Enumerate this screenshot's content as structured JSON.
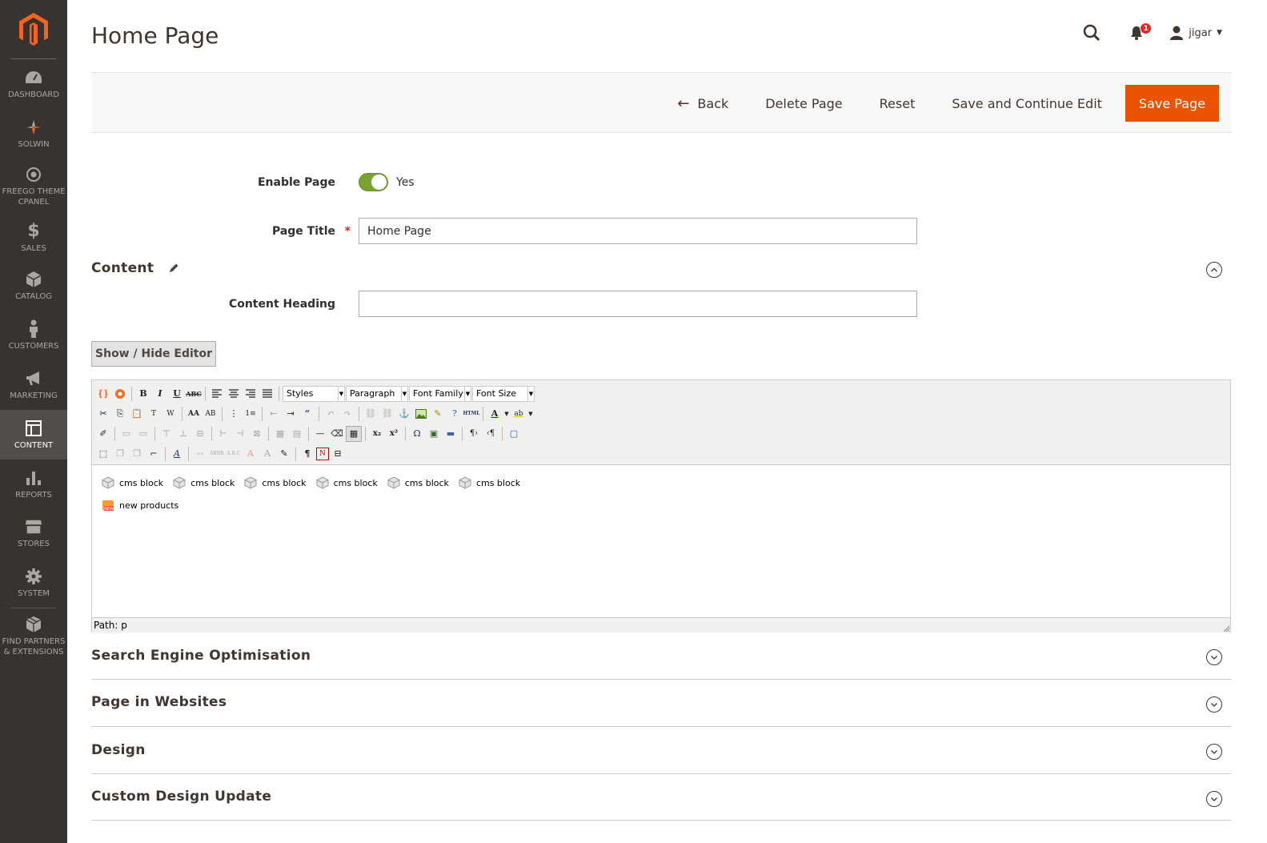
{
  "sidebar": {
    "items": [
      {
        "label": "DASHBOARD",
        "icon": "dashboard-icon"
      },
      {
        "label": "SOLWIN",
        "icon": "solwin-icon"
      },
      {
        "label": "FREEGO THEME CPANEL",
        "icon": "freego-icon"
      },
      {
        "label": "SALES",
        "icon": "dollar-icon"
      },
      {
        "label": "CATALOG",
        "icon": "box-icon"
      },
      {
        "label": "CUSTOMERS",
        "icon": "person-icon"
      },
      {
        "label": "MARKETING",
        "icon": "megaphone-icon"
      },
      {
        "label": "CONTENT",
        "icon": "layout-icon"
      },
      {
        "label": "REPORTS",
        "icon": "bar-chart-icon"
      },
      {
        "label": "STORES",
        "icon": "store-icon"
      },
      {
        "label": "SYSTEM",
        "icon": "gear-icon"
      },
      {
        "label": "FIND PARTNERS & EXTENSIONS",
        "icon": "blocks-icon"
      }
    ],
    "active": "CONTENT"
  },
  "header": {
    "title": "Home Page",
    "notification_count": "1",
    "username": "jigar"
  },
  "actions": {
    "back": "Back",
    "delete": "Delete Page",
    "reset": "Reset",
    "save_continue": "Save and Continue Edit",
    "save": "Save Page"
  },
  "form": {
    "enable_label": "Enable Page",
    "enable_value": "Yes",
    "title_label": "Page Title",
    "title_required": "*",
    "title_value": "Home Page"
  },
  "content_section": {
    "title": "Content",
    "heading_label": "Content Heading",
    "heading_value": "",
    "show_hide": "Show / Hide Editor"
  },
  "editor": {
    "selects": {
      "styles": "Styles",
      "paragraph": "Paragraph",
      "font_family": "Font Family",
      "font_size": "Font Size"
    },
    "widgets": [
      "cms block",
      "cms block",
      "cms block",
      "cms block",
      "cms block",
      "cms block",
      "new products"
    ],
    "path": "Path: p"
  },
  "sections": [
    {
      "title": "Search Engine Optimisation"
    },
    {
      "title": "Page in Websites"
    },
    {
      "title": "Design"
    },
    {
      "title": "Custom Design Update"
    }
  ],
  "colors": {
    "sidebar_bg": "#373330",
    "primary_button": "#eb5202",
    "toggle_on": "#79a22e"
  }
}
